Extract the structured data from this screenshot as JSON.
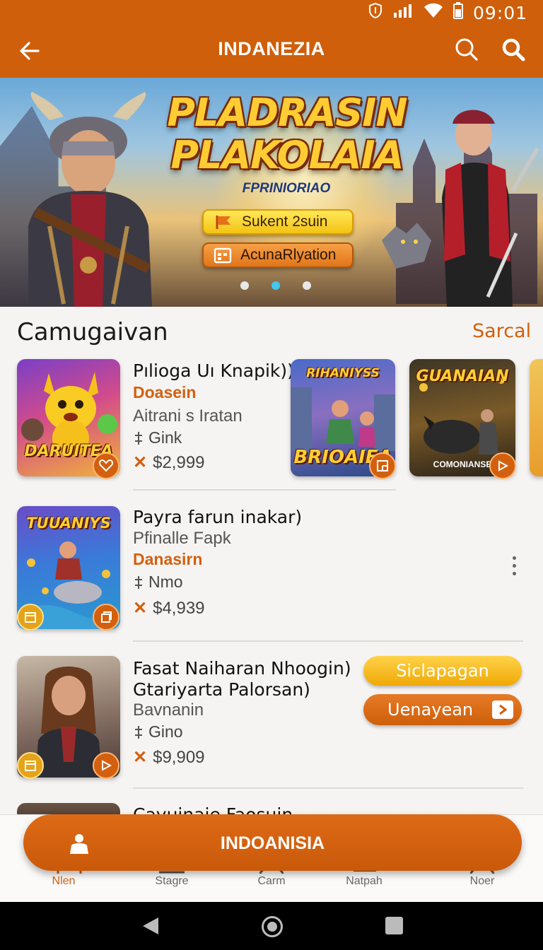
{
  "status_bar": {
    "time": "09:01"
  },
  "header": {
    "title": "INDANEZIA"
  },
  "banner": {
    "title_line1": "PLADRASIN",
    "title_line2": "PLAKOLAIA",
    "subtitle": "FPRINIORIAO",
    "button_primary": "Sukent 2suin",
    "button_secondary": "AcunaRlyation",
    "active_slide": 2,
    "slide_count": 3
  },
  "section": {
    "title": "Camugaivan",
    "link": "Sarcal"
  },
  "row1": {
    "thumb_title": "DARUITEA",
    "title": "Pılioga Uı Knapik))",
    "category": "Doasein",
    "subtitle": "Aitrani s Iratan",
    "meta": "Gink",
    "price": "$2,999",
    "card2_title_top": "RIHANIYSS",
    "card2_title_bottom": "BRIOAIEA",
    "card3_title": "GUANAIAN",
    "card3_subtitle": "COMONIANSE"
  },
  "row2": {
    "thumb_title": "TUUANIYS",
    "title": "Payra farun inakar)",
    "subtitle": "Pfinalle Fapk",
    "category": "Danasirn",
    "meta": "Nmo",
    "price": "$4,939"
  },
  "row3": {
    "title_line1": "Fasat Naiharan Nhoogin)",
    "title_line2": "Gtariyarta Palorsan)",
    "subtitle": "Bavnanin",
    "meta": "Gino",
    "price": "$9,909",
    "button_primary": "Siclapagan",
    "button_secondary": "Uenayean"
  },
  "row4": {
    "title": "Cayuinaie Faosuin"
  },
  "cta": {
    "label": "INDOANISIA"
  },
  "bottom_nav": {
    "items": [
      {
        "label": "Nlen",
        "active": true
      },
      {
        "label": "Stagre",
        "active": false
      },
      {
        "label": "Carm",
        "active": false
      },
      {
        "label": "Natpah",
        "active": false
      },
      {
        "label": "Noer",
        "active": false
      }
    ]
  },
  "colors": {
    "brand": "#cf5f0a",
    "accent_gold": "#f0a806",
    "dot_active": "#41c8ee"
  }
}
